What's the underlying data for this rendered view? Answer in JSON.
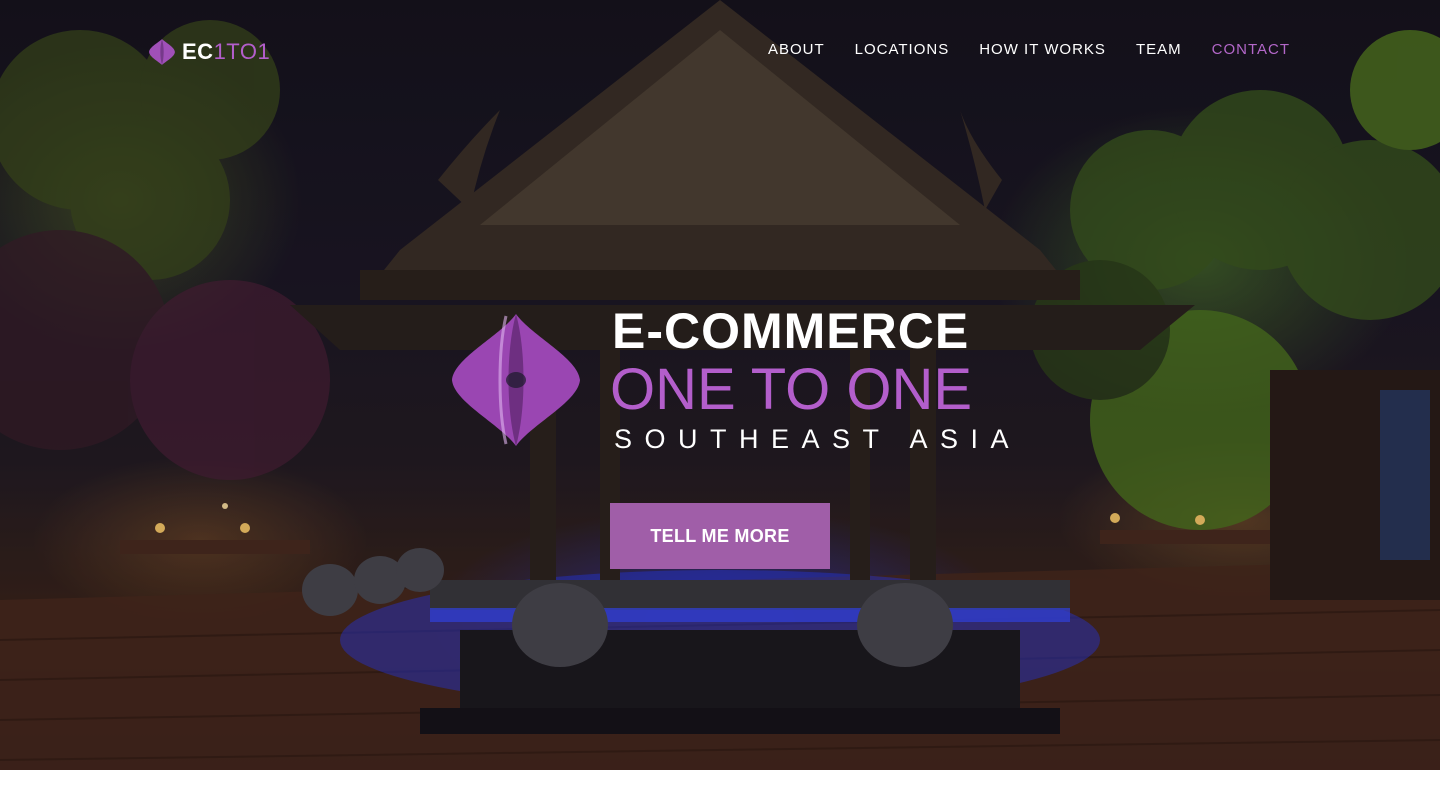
{
  "nav": {
    "brand_bold": "EC",
    "brand_light": "1TO1",
    "links": [
      {
        "label": "ABOUT"
      },
      {
        "label": "LOCATIONS"
      },
      {
        "label": "HOW IT WORKS"
      },
      {
        "label": "TEAM"
      },
      {
        "label": "CONTACT",
        "active": true
      }
    ]
  },
  "hero": {
    "title": "E-COMMERCE",
    "subtitle": "ONE TO ONE",
    "region": "SOUTHEAST ASIA",
    "cta_label": "TELL ME MORE",
    "background_icon": "night-pavilion-photo"
  },
  "colors": {
    "accent": "#b35ecb",
    "button": "#a05ea8",
    "text": "#ffffff"
  }
}
